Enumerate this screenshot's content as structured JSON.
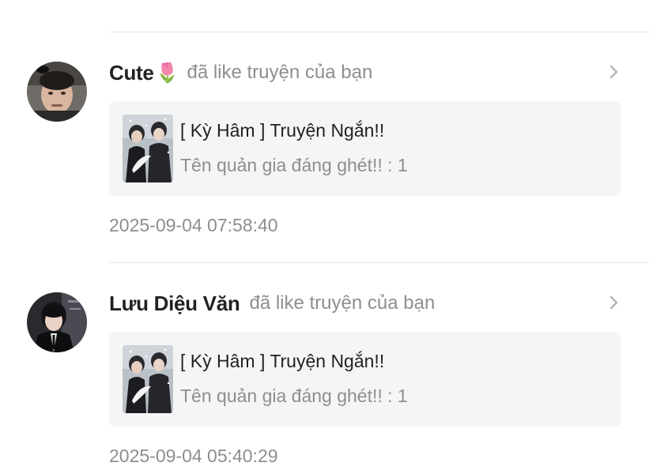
{
  "notifications": [
    {
      "user_name": "Cute",
      "user_emoji": "🌷",
      "action": "đã like truyện của bạn",
      "story_title": "[ Kỳ Hâm ] Truyện Ngắn!!",
      "story_chapter": "Tên quản gia đáng ghét!! : 1",
      "timestamp": "2025-09-04 07:58:40",
      "avatar_icon": "avatar-photo-icon"
    },
    {
      "user_name": "Lưu Diệu Văn",
      "user_emoji": "",
      "action": "đã like truyện của bạn",
      "story_title": "[ Kỳ Hâm ] Truyện Ngắn!!",
      "story_chapter": "Tên quản gia đáng ghét!! : 1",
      "timestamp": "2025-09-04 05:40:29",
      "avatar_icon": "avatar-photo-icon"
    }
  ],
  "colors": {
    "primary_text": "#222222",
    "secondary_text": "#8e8e8e",
    "card_background": "#f5f5f6",
    "divider": "#e6e6e6",
    "chevron": "#b5b5b5"
  },
  "icons": {
    "chevron": "chevron-right-icon",
    "thumbnail": "story-cover-icon"
  }
}
